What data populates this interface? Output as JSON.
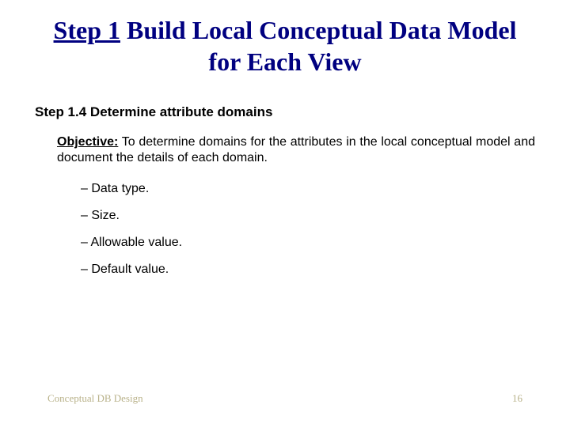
{
  "title_underlined": "Step 1",
  "title_rest": " Build Local Conceptual Data Model for Each View",
  "section_heading": "Step 1.4  Determine attribute domains",
  "objective_label": "Objective:",
  "objective_text": " To determine domains for the attributes in the local conceptual model and document the details of each domain.",
  "bullets": [
    "Data type.",
    "Size.",
    "Allowable value.",
    "Default value."
  ],
  "footer_left": "Conceptual DB Design",
  "footer_right": "16"
}
